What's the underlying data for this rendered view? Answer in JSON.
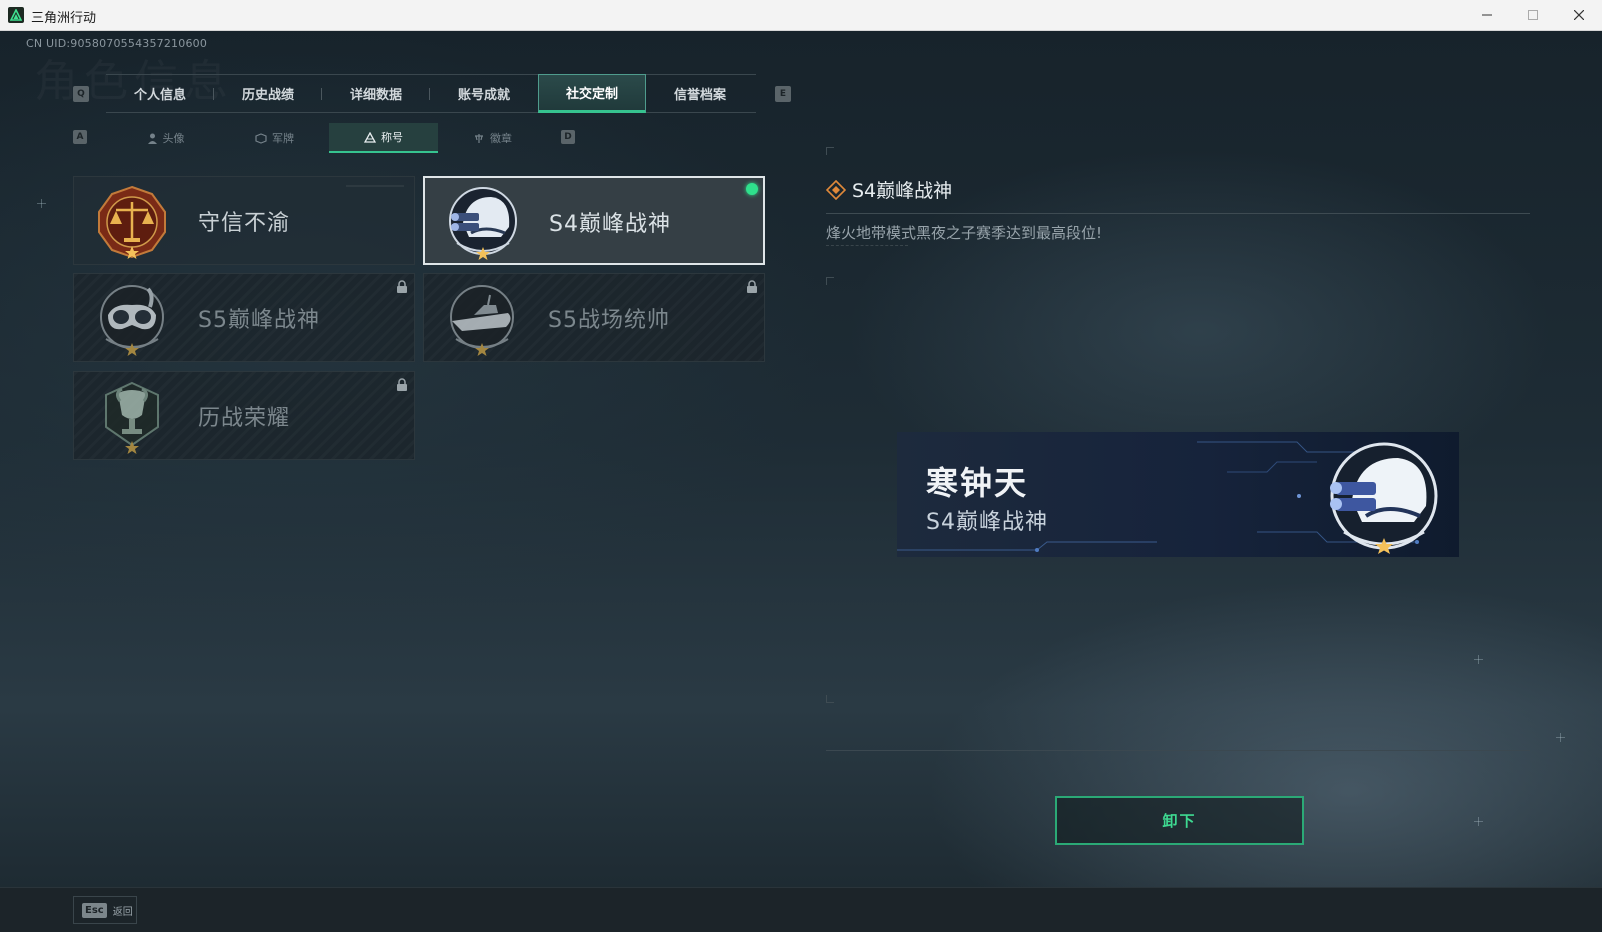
{
  "window": {
    "title": "三角洲行动"
  },
  "header": {
    "uid_text": "CN UID:9058070554357210600",
    "ghost_title": "角色信息"
  },
  "tabs": {
    "prev_key": "Q",
    "next_key": "E",
    "items": [
      {
        "label": "个人信息"
      },
      {
        "label": "历史战绩"
      },
      {
        "label": "详细数据"
      },
      {
        "label": "账号成就"
      },
      {
        "label": "社交定制",
        "active": true
      },
      {
        "label": "信誉档案"
      }
    ]
  },
  "subtabs": {
    "prev_key": "A",
    "next_key": "D",
    "items": [
      {
        "label": "头像",
        "icon": "person-icon"
      },
      {
        "label": "军牌",
        "icon": "dogtag-icon"
      },
      {
        "label": "称号",
        "icon": "title-icon",
        "active": true
      },
      {
        "label": "徽章",
        "icon": "emblem-icon"
      }
    ]
  },
  "titles": [
    {
      "name": "守信不渝",
      "badge": "scales-badge-icon",
      "locked": false,
      "selected": false
    },
    {
      "name": "S4巅峰战神",
      "badge": "night-vision-helmet-badge-icon",
      "locked": false,
      "selected": true,
      "equipped": true
    },
    {
      "name": "S5巅峰战神",
      "badge": "diving-mask-badge-icon",
      "locked": true
    },
    {
      "name": "S5战场统帅",
      "badge": "speedboat-badge-icon",
      "locked": true
    },
    {
      "name": "历战荣耀",
      "badge": "trophy-badge-icon",
      "locked": true
    }
  ],
  "detail": {
    "title": "S4巅峰战神",
    "description": "烽火地带模式黑夜之子赛季达到最高段位!"
  },
  "preview": {
    "player_name": "寒钟天",
    "title": "S4巅峰战神"
  },
  "actions": {
    "unequip_label": "卸下"
  },
  "footer": {
    "esc_key": "Esc",
    "back_label": "返回"
  },
  "colors": {
    "accent": "#36c38f",
    "equipped": "#2fe08c",
    "detail_icon": "#e0893a"
  }
}
